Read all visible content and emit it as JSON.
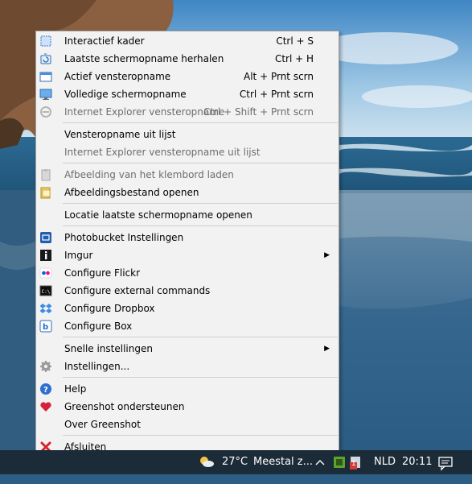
{
  "menu": {
    "items": [
      {
        "label": "Interactief kader",
        "shortcut": "Ctrl + S",
        "icon": "region-icon"
      },
      {
        "label": "Laatste schermopname herhalen",
        "shortcut": "Ctrl + H",
        "icon": "repeat-capture-icon"
      },
      {
        "label": "Actief vensteropname",
        "shortcut": "Alt + Prnt scrn",
        "icon": "window-capture-icon"
      },
      {
        "label": "Volledige schermopname",
        "shortcut": "Ctrl + Prnt scrn",
        "icon": "fullscreen-capture-icon"
      },
      {
        "label": "Internet Explorer vensteropname",
        "shortcut": "Ctrl + Shift + Prnt scrn",
        "icon": "internet-explorer-icon",
        "disabled": true
      },
      {
        "label": "Vensteropname uit lijst"
      },
      {
        "label": "Internet Explorer vensteropname uit lijst",
        "disabled": true
      },
      {
        "label": "Afbeelding van het klembord laden",
        "icon": "clipboard-icon",
        "disabled": true
      },
      {
        "label": "Afbeeldingsbestand openen",
        "icon": "open-file-icon"
      },
      {
        "label": "Locatie laatste schermopname openen"
      },
      {
        "label": "Photobucket Instellingen",
        "icon": "photobucket-icon"
      },
      {
        "label": "Imgur",
        "icon": "imgur-icon",
        "submenu": true
      },
      {
        "label": "Configure Flickr",
        "icon": "flickr-icon"
      },
      {
        "label": "Configure external commands",
        "icon": "command-prompt-icon"
      },
      {
        "label": "Configure Dropbox",
        "icon": "dropbox-icon"
      },
      {
        "label": "Configure Box",
        "icon": "box-icon"
      },
      {
        "label": "Snelle instellingen",
        "submenu": true
      },
      {
        "label": "Instellingen...",
        "icon": "gear-icon"
      },
      {
        "label": "Help",
        "icon": "help-icon"
      },
      {
        "label": "Greenshot ondersteunen",
        "icon": "heart-icon"
      },
      {
        "label": "Over Greenshot"
      },
      {
        "label": "Afsluiten",
        "icon": "close-icon"
      }
    ]
  },
  "taskbar": {
    "temperature": "27°C",
    "weather": "Meestal z...",
    "language": "NLD",
    "time": "20:11",
    "notification_badge": "1"
  },
  "colors": {
    "menu_bg": "#f2f2f2",
    "taskbar_bg": "#1c2b38",
    "disabled_text": "#6d6d6d"
  }
}
